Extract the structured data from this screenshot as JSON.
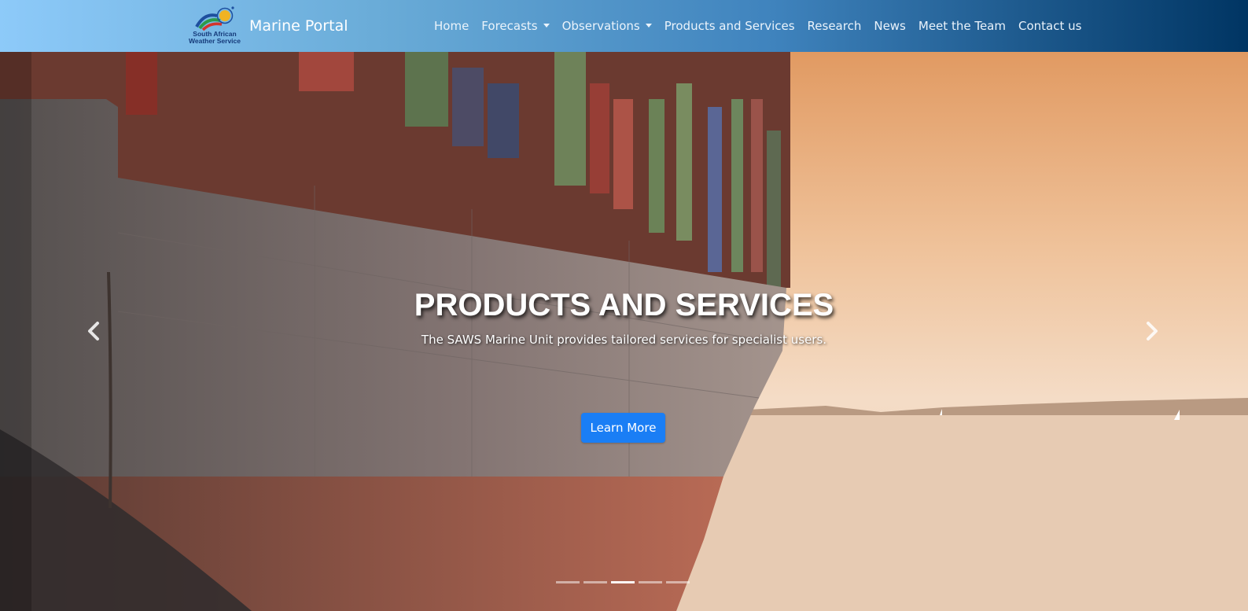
{
  "brand": {
    "logo_lines": [
      "South African",
      "Weather Service"
    ],
    "name": "Marine Portal"
  },
  "nav": {
    "items": [
      {
        "label": "Home",
        "dropdown": false
      },
      {
        "label": "Forecasts",
        "dropdown": true
      },
      {
        "label": "Observations",
        "dropdown": true
      },
      {
        "label": "Products and Services",
        "dropdown": false
      },
      {
        "label": "Research",
        "dropdown": false
      },
      {
        "label": "News",
        "dropdown": false
      },
      {
        "label": "Meet the Team",
        "dropdown": false
      },
      {
        "label": "Contact us",
        "dropdown": false
      }
    ]
  },
  "carousel": {
    "title": "PRODUCTS AND SERVICES",
    "subtitle": "The SAWS Marine Unit provides tailored services for specialist users.",
    "button_label": "Learn More",
    "slide_count": 5,
    "active_slide": 3,
    "prev_icon": "chevron-left-icon",
    "next_icon": "chevron-right-icon"
  },
  "colors": {
    "nav_gradient_start": "#8dcaf9",
    "nav_gradient_end": "#003563",
    "button": "#1a7ef5"
  }
}
